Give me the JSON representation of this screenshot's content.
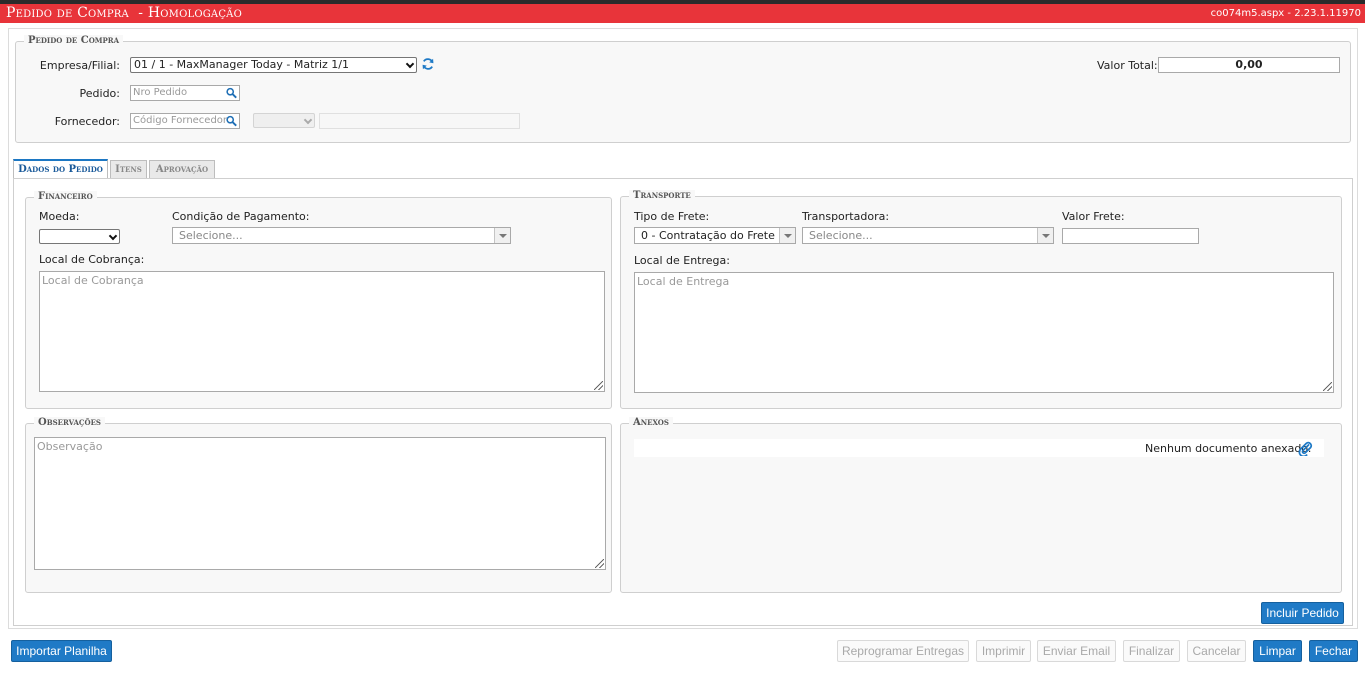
{
  "header": {
    "title": "Pedido de Compra  - Homologação",
    "version": "co074m5.aspx - 2.23.1.11970"
  },
  "pedido_section": {
    "legend": "Pedido de Compra",
    "empresa_label": "Empresa/Filial:",
    "empresa_value": "01 / 1 - MaxManager Today - Matriz 1/1",
    "pedido_label": "Pedido:",
    "pedido_placeholder": "Nro Pedido",
    "fornecedor_label": "Fornecedor:",
    "fornecedor_placeholder": "Código Fornecedor",
    "valor_total_label": "Valor Total:",
    "valor_total_value": "0,00"
  },
  "tabs": [
    {
      "label": "Dados do Pedido",
      "active": true
    },
    {
      "label": "Itens",
      "active": false
    },
    {
      "label": "Aprovação",
      "active": false
    }
  ],
  "financeiro": {
    "legend": "Financeiro",
    "moeda_label": "Moeda:",
    "moeda_value": "",
    "condicao_label": "Condição de Pagamento:",
    "condicao_placeholder": "Selecione...",
    "local_cobranca_label": "Local de Cobrança:",
    "local_cobranca_placeholder": "Local de Cobrança"
  },
  "transporte": {
    "legend": "Transporte",
    "tipo_frete_label": "Tipo de Frete:",
    "tipo_frete_value": "0 - Contratação do Frete po...",
    "transportadora_label": "Transportadora:",
    "transportadora_placeholder": "Selecione...",
    "valor_frete_label": "Valor Frete:",
    "valor_frete_value": "",
    "local_entrega_label": "Local de Entrega:",
    "local_entrega_placeholder": "Local de Entrega"
  },
  "observacoes": {
    "legend": "Observações",
    "placeholder": "Observação"
  },
  "anexos": {
    "legend": "Anexos",
    "empty_text": "Nenhum documento anexado."
  },
  "buttons": {
    "incluir_pedido": "Incluir Pedido",
    "importar_planilha": "Importar Planilha",
    "reprogramar": "Reprogramar Entregas",
    "imprimir": "Imprimir",
    "enviar_email": "Enviar Email",
    "finalizar": "Finalizar",
    "cancelar": "Cancelar",
    "limpar": "Limpar",
    "fechar": "Fechar"
  },
  "colors": {
    "header_bg": "#e8343a",
    "primary_button": "#1f7ac6",
    "active_tab_text": "#1a5a9a"
  }
}
